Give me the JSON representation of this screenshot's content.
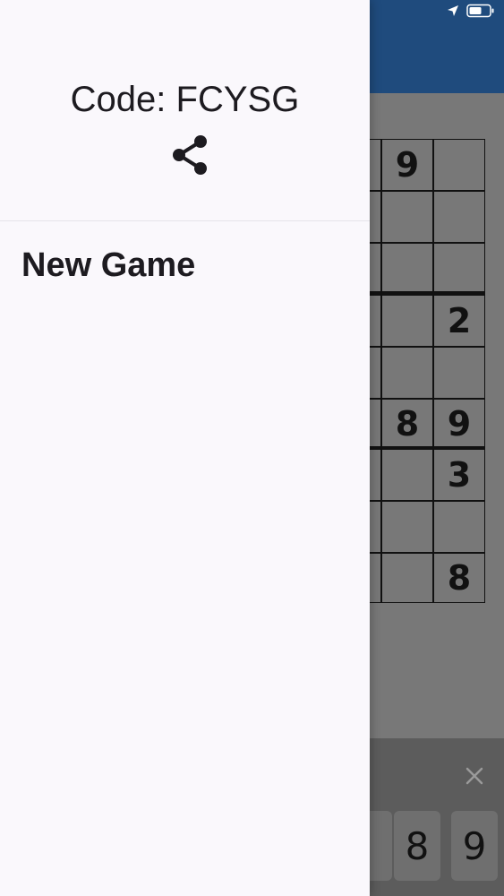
{
  "drawer": {
    "game_code": "Code: FCYSG",
    "share_icon": "share-icon",
    "new_game_label": "New Game"
  },
  "board": {
    "visible_digits": {
      "r0c2": "9",
      "r3c3": "2",
      "r5c2": "8",
      "r5c3": "9",
      "r6c3": "3",
      "r8c3": "8"
    }
  },
  "keypad": {
    "visible_keys": [
      "8",
      "9"
    ],
    "close_icon": "close-icon"
  },
  "status_bar": {
    "icons": [
      "location-arrow-icon",
      "battery-icon"
    ]
  },
  "colors": {
    "header_blue": "#1f4b7d",
    "drawer_bg": "#faf8fc",
    "scrim_gray": "#787878",
    "keypad_bg": "#5c5c5c"
  }
}
